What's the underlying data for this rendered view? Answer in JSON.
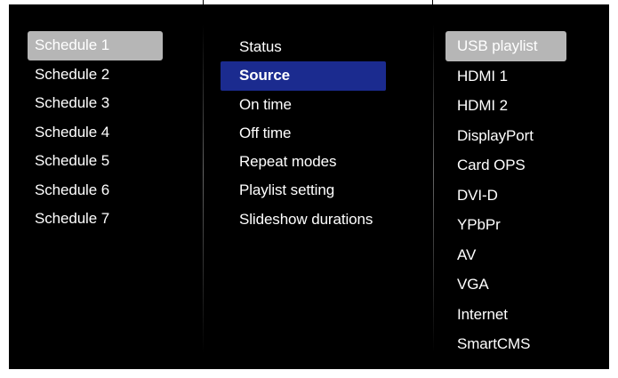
{
  "schedules": {
    "items": [
      "Schedule 1",
      "Schedule 2",
      "Schedule 3",
      "Schedule 4",
      "Schedule 5",
      "Schedule 6",
      "Schedule 7"
    ],
    "selected_index": 0
  },
  "settings": {
    "items": [
      "Status",
      "Source",
      "On time",
      "Off time",
      "Repeat modes",
      "Playlist setting",
      "Slideshow durations"
    ],
    "selected_index": 1
  },
  "sources": {
    "items": [
      "USB playlist",
      "HDMI 1",
      "HDMI 2",
      "DisplayPort",
      "Card OPS",
      "DVI-D",
      "YPbPr",
      "AV",
      "VGA",
      "Internet",
      "SmartCMS"
    ],
    "selected_index": 0
  },
  "colors": {
    "background": "#000000",
    "text": "#ffffff",
    "focus_highlight": "#1b2b8f",
    "selection_highlight": "#b6b6b6"
  }
}
